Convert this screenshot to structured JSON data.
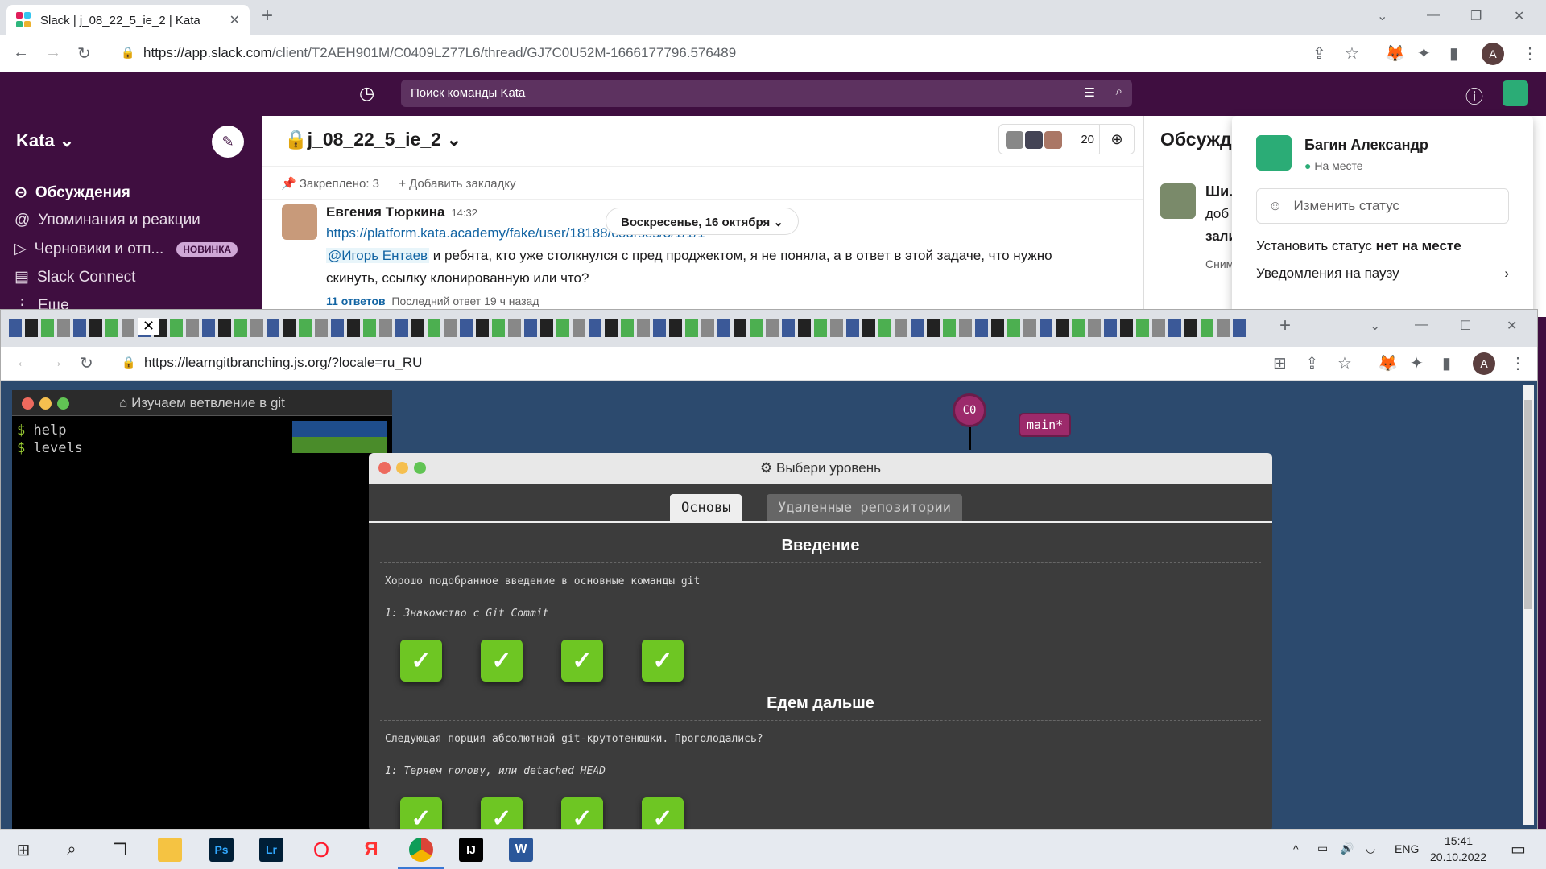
{
  "browser1": {
    "tab_title": "Slack | j_08_22_5_ie_2 | Kata",
    "url_host": "https://app.slack.com",
    "url_path": "/client/T2AEH901M/C0409LZ77L6/thread/GJ7C0U52M-1666177796.576489"
  },
  "slack": {
    "search_placeholder": "Поиск команды Kata",
    "workspace": "Kata",
    "sidebar_items": [
      "Обсуждения",
      "Упоминания и реакции",
      "Черновики и отп...",
      "Slack Connect",
      "Еще"
    ],
    "new_badge": "НОВИНКА",
    "channel": "j_08_22_5_ie_2",
    "member_count": "20",
    "pinned": "Закреплено: 3",
    "add_bookmark": "Добавить закладку",
    "message": {
      "author": "Евгения Тюркина",
      "time": "14:32",
      "link": "https://platform.kata.academy/fake/user/18188/courses/3/1/1/1",
      "mention": "@Игорь Ентаев",
      "text1": " и ребята, кто уже столкнулся с пред проджектом, я не поняла, а в ответ в этой задаче, что нужно",
      "text2": "скинуть, ссылку клонированную или что?",
      "replies": "11 ответов",
      "last_reply": "Последний ответ 19 ч назад"
    },
    "date_pill": "Воскресенье, 16 октября",
    "thread_title": "Обсужд",
    "thread_author": "Ши...",
    "thread_text1": "доб",
    "thread_text2": "зали",
    "thread_text3": "Сним",
    "user": {
      "name": "Багин Александр",
      "status": "На месте",
      "change_status": "Изменить статус",
      "set_away_prefix": "Установить статус ",
      "set_away_bold": "нет на месте",
      "pause": "Уведомления на паузу"
    }
  },
  "browser2": {
    "url": "https://learngitbranching.js.org/?locale=ru_RU"
  },
  "git": {
    "terminal_title": "Изучаем ветвление в git",
    "terminal_lines": [
      "help",
      "levels"
    ],
    "commit_c0": "C0",
    "branch_main": "main*",
    "dialog_title": "Выбери уровень",
    "tab_basics": "Основы",
    "tab_remote": "Удаленные репозитории",
    "sections": [
      {
        "title": "Введение",
        "desc": "Хорошо подобранное введение в основные команды git",
        "first_level": "1: Знакомство с Git Commit"
      },
      {
        "title": "Едем дальше",
        "desc": "Следующая порция абсолютной git-крутотенюшки. Проголодались?",
        "first_level": "1: Теряем голову, или detached HEAD"
      }
    ],
    "level_mark": "✓"
  },
  "taskbar": {
    "lang": "ENG",
    "time": "15:41",
    "date": "20.10.2022"
  }
}
